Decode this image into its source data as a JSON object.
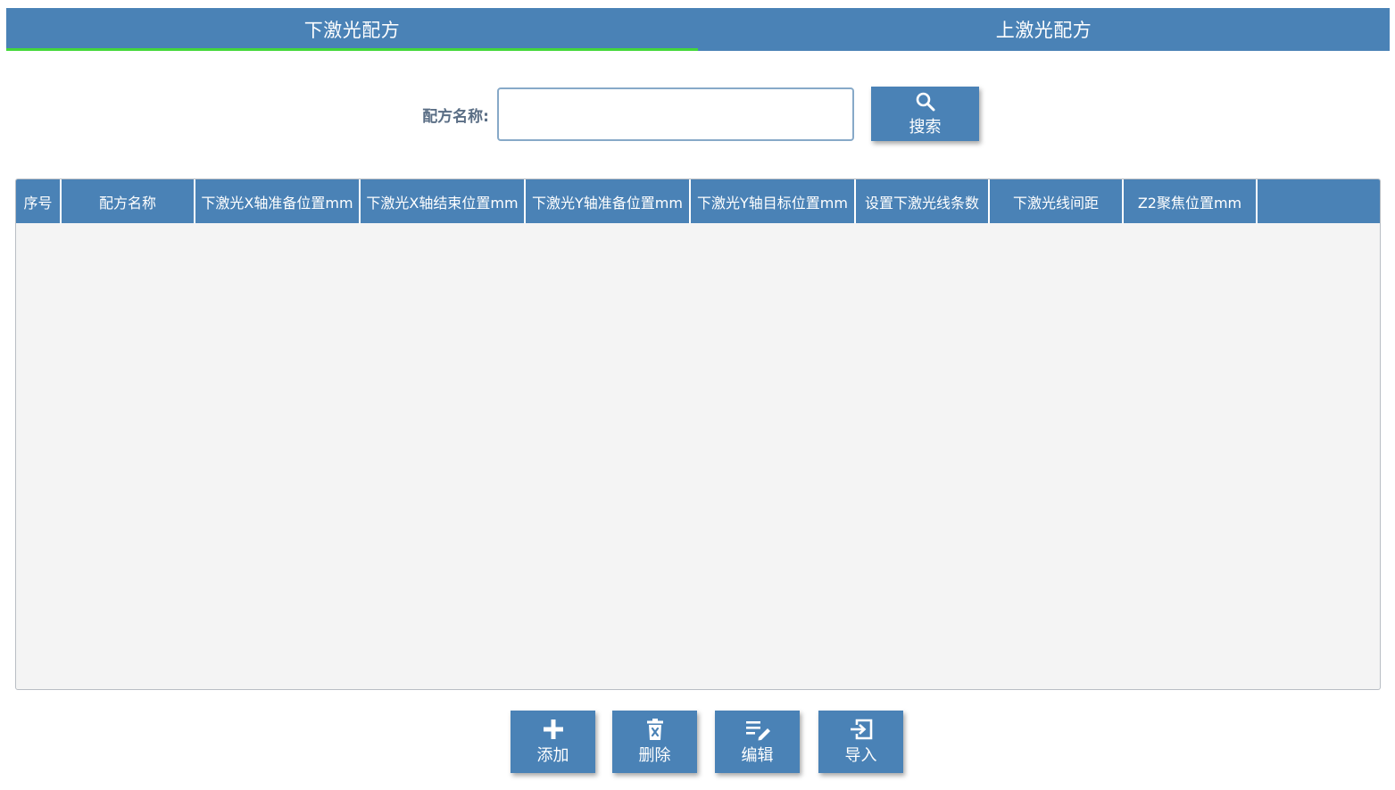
{
  "tabs": [
    {
      "label": "下激光配方",
      "active": true
    },
    {
      "label": "上激光配方",
      "active": false
    }
  ],
  "search": {
    "label": "配方名称:",
    "value": "",
    "button_label": "搜索"
  },
  "table": {
    "columns": [
      "序号",
      "配方名称",
      "下激光X轴准备位置mm",
      "下激光X轴结束位置mm",
      "下激光Y轴准备位置mm",
      "下激光Y轴目标位置mm",
      "设置下激光线条数",
      "下激光线间距",
      "Z2聚焦位置mm",
      ""
    ],
    "rows": []
  },
  "actions": {
    "add": "添加",
    "delete": "删除",
    "edit": "编辑",
    "import": "导入"
  },
  "colors": {
    "primary": "#4a82b6",
    "active_tab_indicator": "#44d83a",
    "table_body": "#f4f4f4"
  }
}
